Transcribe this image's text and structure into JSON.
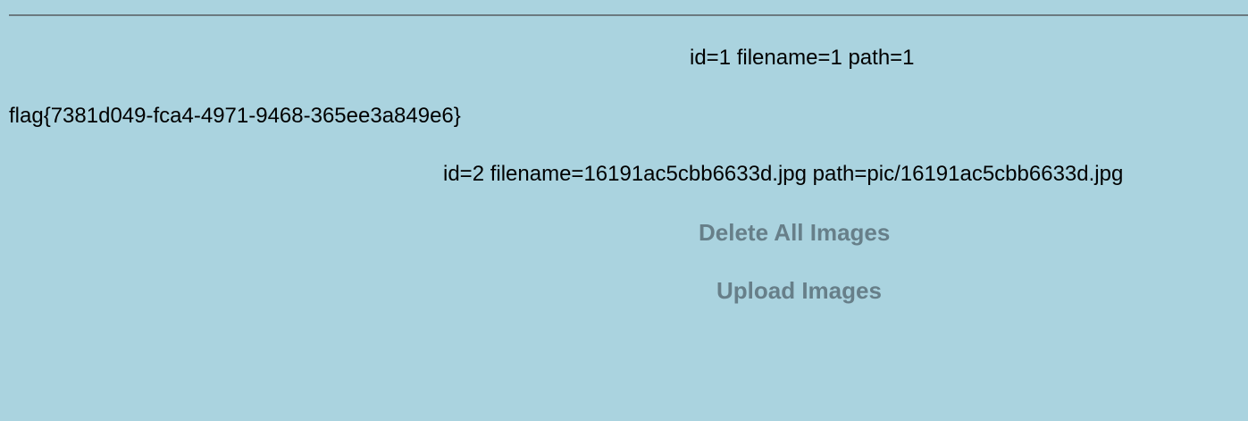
{
  "entries": [
    {
      "text": "id=1 filename=1 path=1"
    },
    {
      "text": "id=2 filename=16191ac5cbb6633d.jpg path=pic/16191ac5cbb6633d.jpg"
    }
  ],
  "flag": "flag{7381d049-fca4-4971-9468-365ee3a849e6}",
  "actions": {
    "delete_all": "Delete All Images",
    "upload": "Upload Images"
  },
  "colors": {
    "background": "#aad3df",
    "link": "#677f89"
  }
}
